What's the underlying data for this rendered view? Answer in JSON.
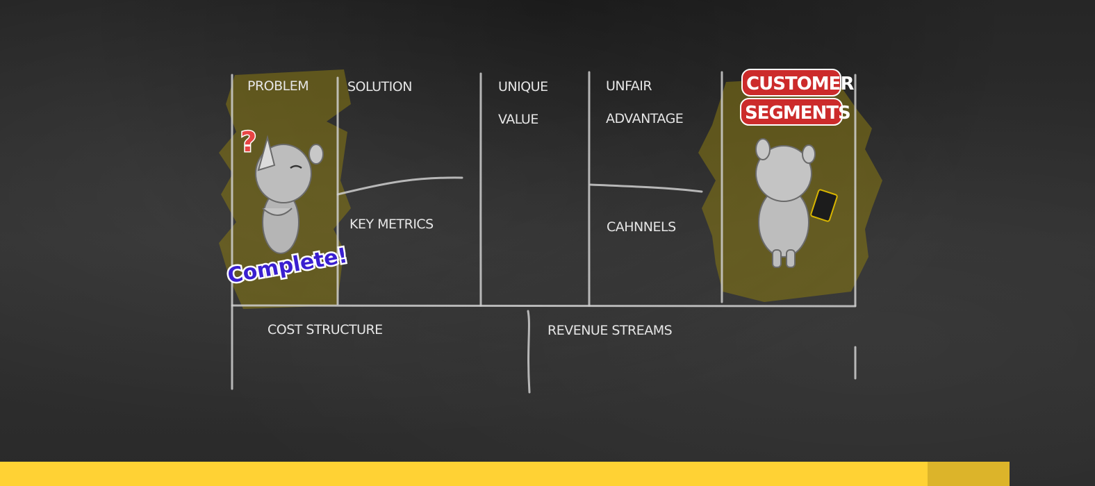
{
  "canvas": {
    "sections": {
      "problem": "PROBLEM",
      "solution": "SOLUTION",
      "unique_value_line1": "UNIQUE",
      "unique_value_line2": "VALUE",
      "unfair_advantage_line1": "UNFAIR",
      "unfair_advantage_line2": "ADVANTAGE",
      "customer_segments_line1": "CUSTOMER",
      "customer_segments_line2": "SEGMENTS",
      "key_metrics": "KEY METRICS",
      "channels": "CAHNNELS",
      "cost_structure": "COST STRUCTURE",
      "revenue_streams": "REVENUE STREAMS"
    },
    "stickers": {
      "complete": "Complete!",
      "question": "?"
    }
  },
  "colors": {
    "chalkboard": "#2b2b2b",
    "chalk": "#e6e6e6",
    "highlight": "#8a7a12",
    "badge_red": "#cc2b2b",
    "complete_blue": "#3a1fd0",
    "footer_yellow": "#ffd234",
    "footer_tab": "#dcb42a"
  }
}
